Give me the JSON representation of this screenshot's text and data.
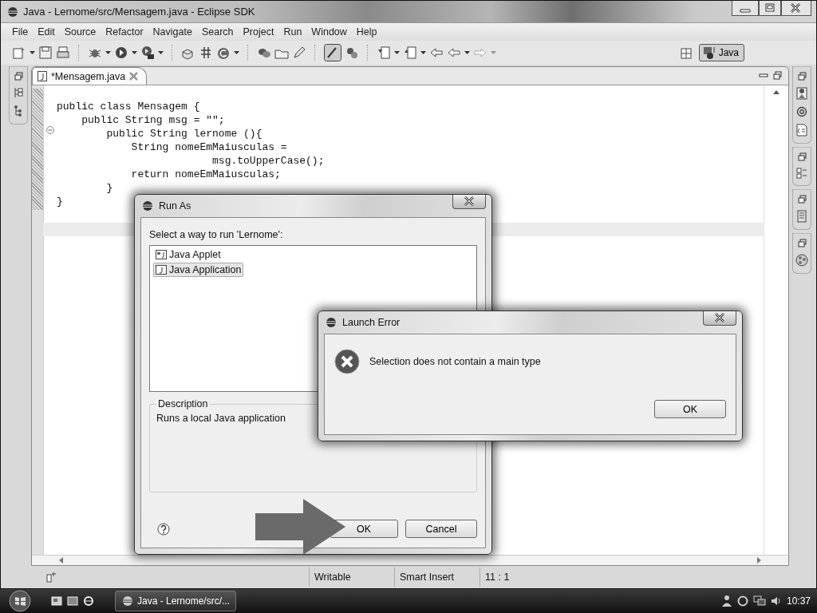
{
  "window": {
    "title": "Java - Lernome/src/Mensagem.java - Eclipse SDK"
  },
  "menu": [
    "File",
    "Edit",
    "Source",
    "Refactor",
    "Navigate",
    "Search",
    "Project",
    "Run",
    "Window",
    "Help"
  ],
  "perspective": {
    "label": "Java",
    "selected": true
  },
  "editor_tabs": [
    {
      "label": "*Mensagem.java",
      "selected": true
    }
  ],
  "code_lines": [
    "public class Mensagem {",
    "    public String msg = \"\";",
    "        public String lernome (){",
    "            String nomeEmMaiusculas =",
    "                         msg.toUpperCase();",
    "            return nomeEmMaiusculas;",
    "        }",
    "}"
  ],
  "status_bar": [
    "Writable",
    "Smart Insert",
    "11 : 1"
  ],
  "taskbar": {
    "task": "Java - Lernome/src/...",
    "clock": "10:37"
  },
  "run_as_dialog": {
    "title": "Run As",
    "prompt": "Select a way to run 'Lernome':",
    "items": [
      {
        "label": "Java Applet",
        "kind": "applet",
        "selected": false
      },
      {
        "label": "Java Application",
        "kind": "application",
        "selected": true
      }
    ],
    "description_label": "Description",
    "description": "Runs a local Java application",
    "buttons": [
      "OK",
      "Cancel"
    ]
  },
  "launch_error_dialog": {
    "title": "Launch Error",
    "message": "Selection does not contain a main type",
    "button": "OK"
  }
}
